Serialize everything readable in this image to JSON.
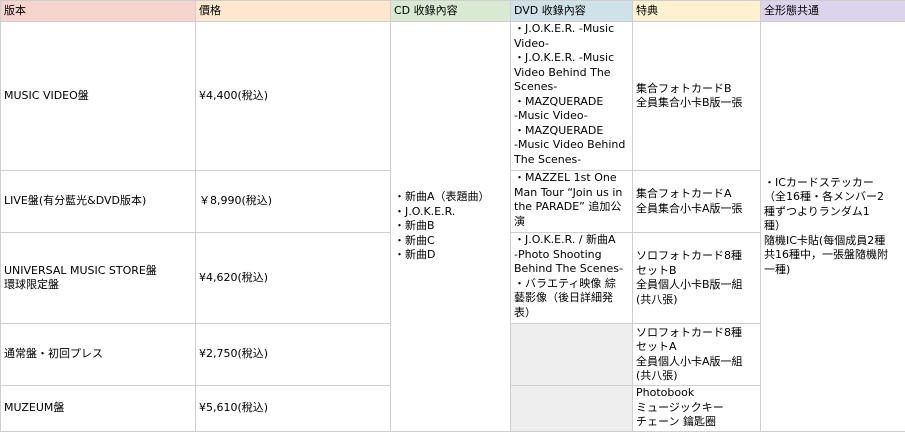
{
  "header": {
    "edition": "版本",
    "price": "價格",
    "cd": "CD 收錄內容",
    "dvd": "DVD 收錄內容",
    "bonus": "特典",
    "common": "全形態共通",
    "colors": {
      "edition": "#f6d5cf",
      "price": "#fde8cf",
      "cd": "#d9ead3",
      "dvd": "#cfe2e7",
      "bonus": "#fdf1cf",
      "common": "#dcd4ec"
    }
  },
  "rows": [
    {
      "edition": "MUSIC VIDEO盤",
      "price": "¥4,400(稅込)",
      "dvd": [
        "・J.O.K.E.R. -Music",
        "Video-",
        "・J.O.K.E.R. -Music",
        "Video Behind The",
        "Scenes-",
        "・MAZQUERADE",
        "-Music Video-",
        "・MAZQUERADE",
        "-Music Video Behind",
        "The Scenes-"
      ],
      "bonus": [
        "集合フォトカードB",
        "全員集合小卡B版一張"
      ]
    },
    {
      "edition": "LIVE盤(有分藍光&DVD版本)",
      "price": "￥8,990(稅込)",
      "dvd": [
        "・MAZZEL 1st One",
        "Man Tour “Join us in",
        "the PARADE” 追加公",
        "演"
      ],
      "bonus": [
        "集合フォトカードA",
        "全員集合小卡A版一張"
      ]
    },
    {
      "edition": [
        "UNIVERSAL MUSIC STORE盤",
        "環球限定盤"
      ],
      "price": "¥4,620(稅込)",
      "dvd": [
        "・J.O.K.E.R. / 新曲A",
        "-Photo Shooting",
        "Behind The Scenes-",
        "・バラエティ映像 綜",
        "藝影像（後日詳細発",
        "表）"
      ],
      "bonus": [
        "ソロフォトカード8種",
        "セットB",
        "全員個人小卡B版一組",
        "(共八張)"
      ]
    },
    {
      "edition": "通常盤・初回プレス",
      "price": "¥2,750(稅込)",
      "dvd": [],
      "bonus": [
        "ソロフォトカード8種",
        "セットA",
        "全員個人小卡A版一組",
        "(共八張)"
      ]
    },
    {
      "edition": "MUZEUM盤",
      "price": "¥5,610(稅込)",
      "dvd": [],
      "bonus": [
        "Photobook",
        "ミュージックキー",
        "チェーン 鑰匙圈"
      ]
    }
  ],
  "cd_common": [
    "・新曲A（表題曲）",
    "・J.O.K.E.R.",
    "・新曲B",
    "・新曲C",
    "・新曲D"
  ],
  "common": [
    "・ICカードステッカー",
    "（全16種・各メンバー2",
    "種ずつよりランダム1",
    "種）",
    "隨機IC卡貼(每個成員2種",
    "共16種中，一張盤隨機附",
    "一種)"
  ]
}
